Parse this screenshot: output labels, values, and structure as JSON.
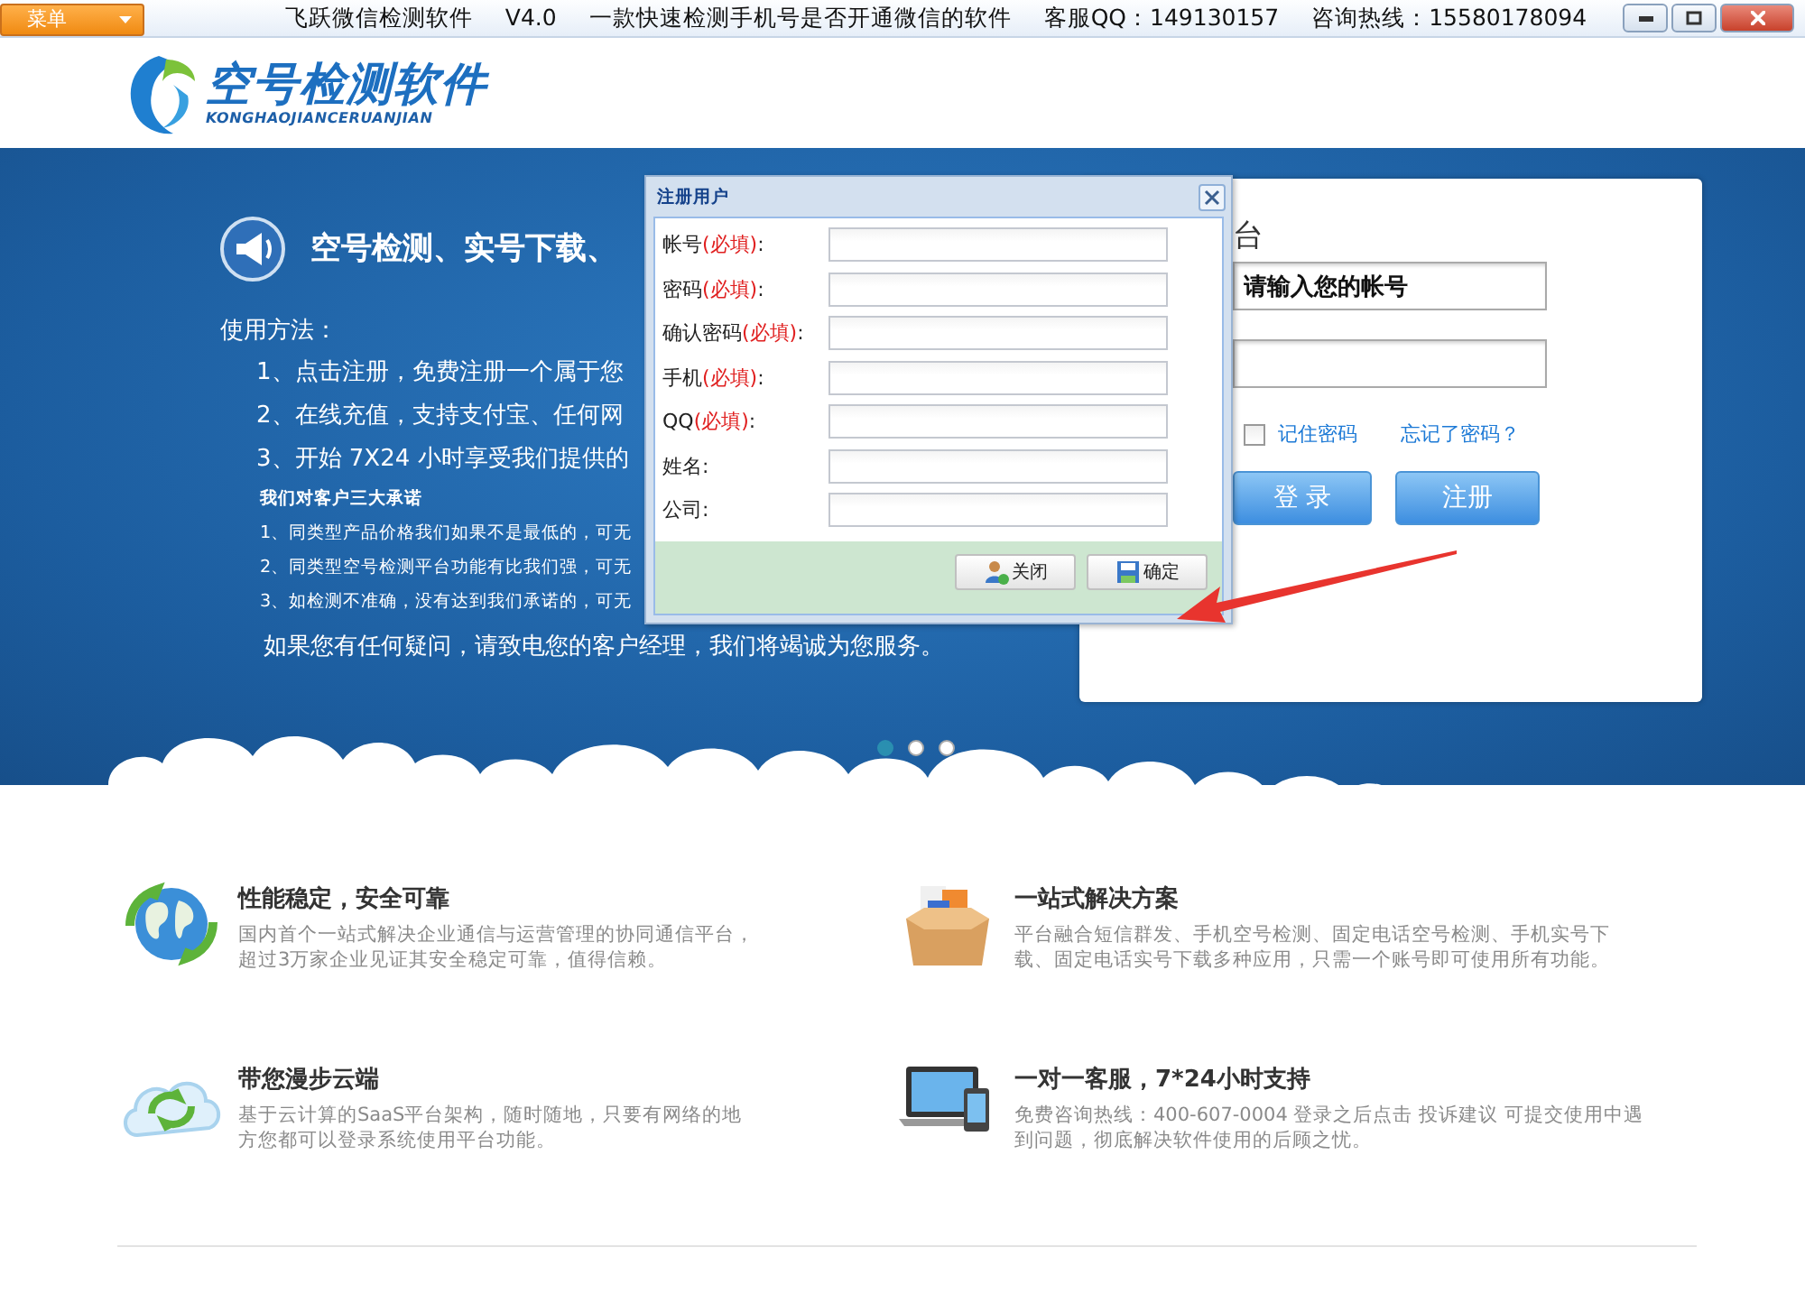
{
  "title_bar": {
    "menu": "菜单",
    "title_parts": [
      "飞跃微信检测软件",
      "V4.0",
      "一款快速检测手机号是否开通微信的软件",
      "客服QQ：149130157",
      "咨询热线：15580178094"
    ]
  },
  "logo": {
    "name": "空号检测软件",
    "pinyin": "KONGHAOJIANCERUANJIAN"
  },
  "banner": {
    "heading": "空号检测、实号下载、",
    "usage_title": "使用方法：",
    "steps": [
      "1、点击注册，免费注册一个属于您",
      "2、在线充值，支持支付宝、任何网",
      "3、开始 7X24 小时享受我们提供的"
    ],
    "promise_title": "我们对客户三大承诺",
    "promises": [
      "1、同类型产品价格我们如果不是最低的，可无",
      "2、同类型空号检测平台功能有比我们强，可无",
      "3、如检测不准确，没有达到我们承诺的，可无"
    ],
    "contact": "如果您有任何疑问，请致电您的客户经理，我们将竭诚为您服务。",
    "slides": [
      {
        "selected": true
      },
      {
        "selected": false
      },
      {
        "selected": false
      }
    ]
  },
  "login": {
    "title": "台",
    "account_value": "请输入您的帐号",
    "remember": {
      "label": "记住密码",
      "checked": false
    },
    "forgot": "忘记了密码？",
    "buttons": [
      "登 录",
      "注册"
    ]
  },
  "dialog": {
    "title": "注册用户",
    "fields": [
      {
        "label": "帐号",
        "note": "(必填)",
        "suffix": ":"
      },
      {
        "label": "密码",
        "note": "(必填)",
        "suffix": ":"
      },
      {
        "label": "确认密码",
        "note": "(必填)",
        "suffix": ":"
      },
      {
        "label": "手机",
        "note": "(必填)",
        "suffix": ":"
      },
      {
        "label": "QQ",
        "note": "(必填)",
        "suffix": ":"
      },
      {
        "label": "姓名",
        "suffix": ":"
      },
      {
        "label": "公司",
        "suffix": ":"
      }
    ],
    "buttons": [
      "关闭",
      "确定"
    ]
  },
  "features": [
    {
      "title": "性能稳定，安全可靠",
      "text": "国内首个一站式解决企业通信与运营管理的协同通信平台，超过3万家企业见证其安全稳定可靠，值得信赖。"
    },
    {
      "title": "一站式解决方案",
      "text": "平台融合短信群发、手机空号检测、固定电话空号检测、手机实号下载、固定电话实号下载多种应用，只需一个账号即可使用所有功能。"
    },
    {
      "title": "带您漫步云端",
      "text": "基于云计算的SaaS平台架构，随时随地，只要有网络的地方您都可以登录系统使用平台功能。"
    },
    {
      "title": "一对一客服，7*24小时支持",
      "text": "免费咨询热线：400-607-0004 登录之后点击 投诉建议 可提交使用中遇到问题，彻底解决软件使用的后顾之忧。"
    }
  ]
}
